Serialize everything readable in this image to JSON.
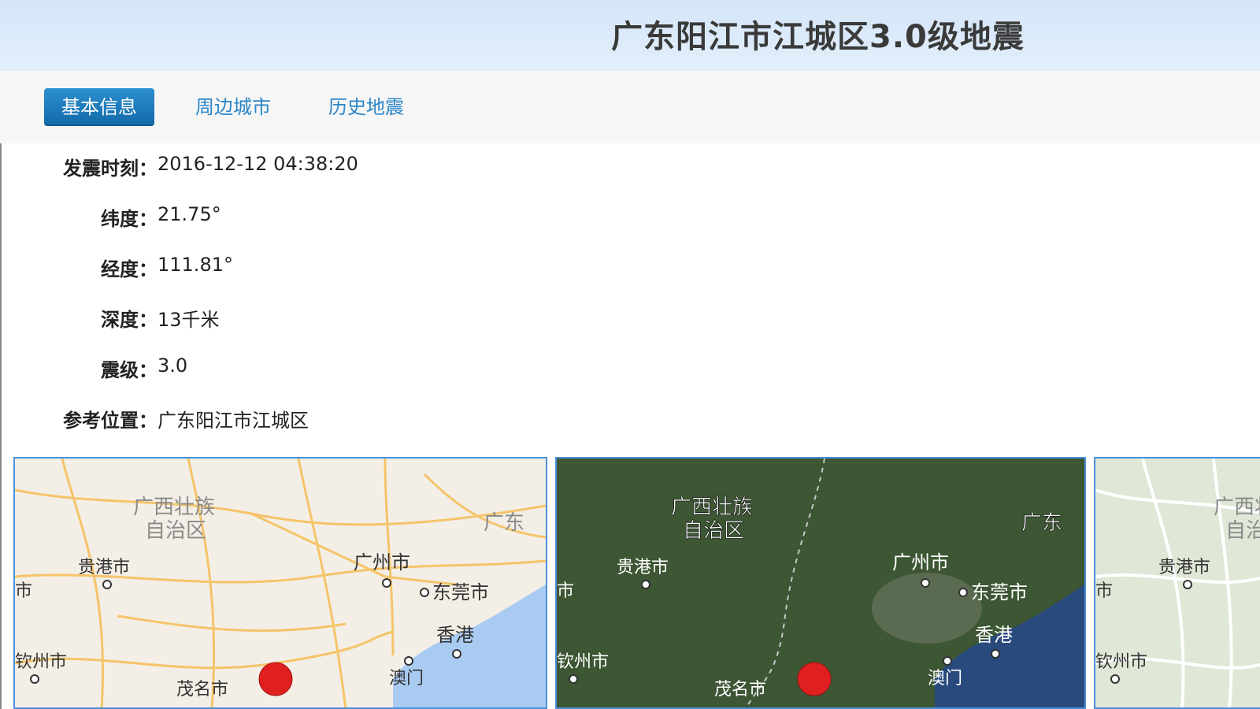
{
  "header": {
    "title": "广东阳江市江城区3.0级地震"
  },
  "tabs": [
    {
      "label": "基本信息",
      "active": true
    },
    {
      "label": "周边城市",
      "active": false
    },
    {
      "label": "历史地震",
      "active": false
    }
  ],
  "info": {
    "time_label": "发震时刻：",
    "time": "2016-12-12 04:38:20",
    "lat_label": "纬度：",
    "lat": "21.75°",
    "lon_label": "经度：",
    "lon": "111.81°",
    "depth_label": "深度：",
    "depth": "13千米",
    "mag_label": "震级：",
    "mag": "3.0",
    "loc_label": "参考位置：",
    "loc": "广东阳江市江城区"
  },
  "maps": {
    "labels": {
      "guangxi_1": "广西壮族",
      "guangxi_2": "自治区",
      "guangdong": "广东",
      "guigang": "贵港市",
      "guangzhou": "广州市",
      "dongguan": "东莞市",
      "hongkong": "香港",
      "macau": "澳门",
      "maoming": "茂名市",
      "qinzhou": "钦州市",
      "left_city": "市"
    },
    "colors": {
      "road_bg": "#f3efe6",
      "road": "#f5c46a",
      "sea": "#a9cbf2",
      "satellite": "#3d5634",
      "sat_sea": "#284a7c",
      "terrain": "#dfe7d6",
      "epicenter": "#e02020"
    }
  }
}
